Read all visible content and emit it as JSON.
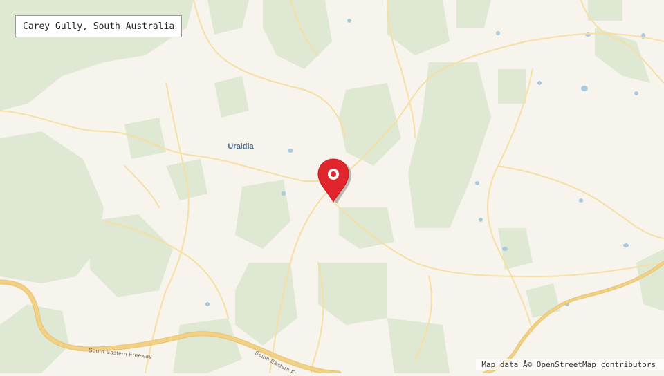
{
  "map": {
    "title": "Carey Gully, South Australia",
    "attribution": "Map data Â© OpenStreetMap contributors",
    "place_labels": {
      "uraidla": "Uraidla"
    },
    "road_labels": {
      "freeway_west": "South Eastern Freeway",
      "freeway_east": "South Eastern Freeway"
    },
    "marker": {
      "name": "Carey Gully",
      "color": "#e0262c"
    },
    "colors": {
      "land": "#f7f4ee",
      "forest": "#dfe8d2",
      "road": "#f6dfa2",
      "freeway": "#f3d184",
      "water": "#a9cbdf"
    }
  }
}
